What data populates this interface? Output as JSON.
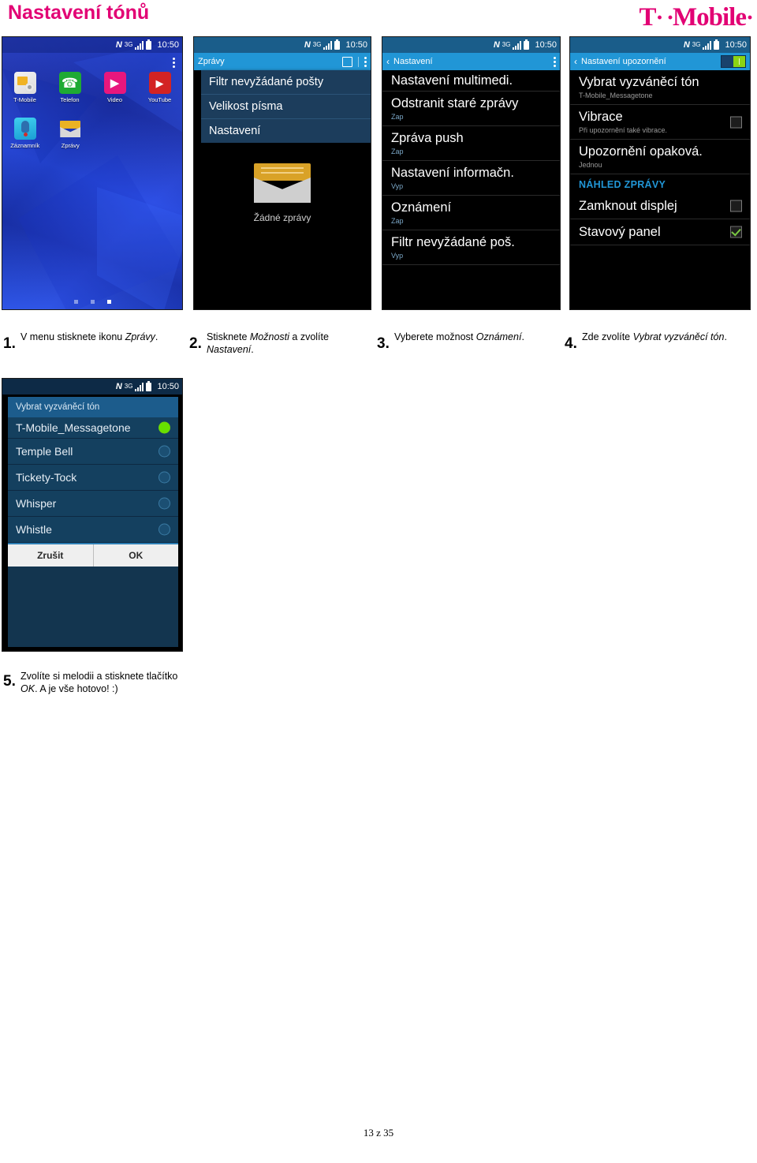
{
  "header": {
    "title": "Nastavení tónů",
    "logo_text": "T",
    "logo_dots": "· ·",
    "logo_word": "Mobile",
    "logo_trailing": "·",
    "brand_color": "#e20074"
  },
  "status_bar": {
    "nfc_icon": "nfc-icon",
    "network_label": "3G",
    "signal_icon": "signal-bars-icon",
    "battery_icon": "battery-icon",
    "time": "10:50"
  },
  "phone1": {
    "name": "home-screen",
    "overflow_icon": "overflow-menu-icon",
    "apps_row1": [
      {
        "label": "T-Mobile",
        "icon": "sim-card-icon"
      },
      {
        "label": "Telefon",
        "icon": "phone-handset-icon"
      },
      {
        "label": "Video",
        "icon": "play-triangle-icon"
      },
      {
        "label": "YouTube",
        "icon": "youtube-play-icon"
      }
    ],
    "apps_row2": [
      {
        "label": "Záznamník",
        "icon": "voicemail-icon"
      },
      {
        "label": "Zprávy",
        "icon": "envelope-icon"
      }
    ],
    "page_dots": 3,
    "active_dot": 3
  },
  "phone2": {
    "appbar_title": "Zprávy",
    "compose_icon": "compose-icon",
    "overflow_icon": "overflow-menu-icon",
    "menu_items": [
      "Filtr nevyžádané pošty",
      "Velikost písma",
      "Nastavení"
    ],
    "empty_icon": "envelope-icon",
    "empty_text": "Žádné zprávy"
  },
  "phone3": {
    "back_icon": "chevron-left-icon",
    "appbar_title": "Nastavení",
    "overflow_icon": "overflow-menu-icon",
    "rows": [
      {
        "title": "Nastavení multimedi.",
        "sub": ""
      },
      {
        "title": "Odstranit staré zprávy",
        "sub": "Zap"
      },
      {
        "title": "Zpráva push",
        "sub": "Zap"
      },
      {
        "title": "Nastavení informačn.",
        "sub": "Vyp"
      },
      {
        "title": "Oznámení",
        "sub": "Zap"
      },
      {
        "title": "Filtr nevyžádané poš.",
        "sub": "Vyp"
      }
    ]
  },
  "phone4": {
    "back_icon": "chevron-left-icon",
    "appbar_title": "Nastavení upozornění",
    "toggle_state": "on",
    "rows": [
      {
        "title": "Vybrat vyzváněcí tón",
        "sub": "T-Mobile_Messagetone",
        "control": "none"
      },
      {
        "title": "Vibrace",
        "sub": "Při upozornění také vibrace.",
        "control": "checkbox-off"
      },
      {
        "title": "Upozornění opaková.",
        "sub": "Jednou",
        "control": "none"
      }
    ],
    "section_header": "NÁHLED ZPRÁVY",
    "rows2": [
      {
        "title": "Zamknout displej",
        "sub": "",
        "control": "checkbox-off"
      },
      {
        "title": "Stavový panel",
        "sub": "",
        "control": "checkbox-on"
      }
    ]
  },
  "phone5": {
    "dialog_title": "Vybrat vyzváněcí tón",
    "options": [
      {
        "label": "T-Mobile_Messagetone",
        "selected": true
      },
      {
        "label": "Temple Bell",
        "selected": false
      },
      {
        "label": "Tickety-Tock",
        "selected": false
      },
      {
        "label": "Whisper",
        "selected": false
      },
      {
        "label": "Whistle",
        "selected": false
      }
    ],
    "cancel_label": "Zrušit",
    "ok_label": "OK"
  },
  "captions": [
    {
      "num": "1.",
      "html": "V menu stisknete ikonu <i>Zprávy</i>."
    },
    {
      "num": "2.",
      "html": "Stisknete <i>Možnosti</i> a zvolíte <i>Nastavení</i>."
    },
    {
      "num": "3.",
      "html": "Vyberete možnost <i>Oznámení</i>."
    },
    {
      "num": "4.",
      "html": "Zde zvolíte <i>Vybrat vyzváněcí tón</i>."
    },
    {
      "num": "5.",
      "html": "Zvolíte si melodii a stisknete tlačítko <i>OK</i>. A je vše hotovo! :)"
    }
  ],
  "footer": "13 z 35"
}
